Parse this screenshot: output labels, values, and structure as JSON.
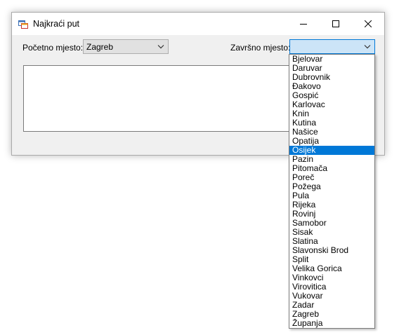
{
  "window": {
    "title": "Najkraći put"
  },
  "form": {
    "start_label": "Početno mjesto:",
    "start_value": "Zagreb",
    "end_label": "Završno mjesto:",
    "end_value": ""
  },
  "dropdown": {
    "selected_index": 10,
    "items": [
      "Bjelovar",
      "Daruvar",
      "Dubrovnik",
      "Đakovo",
      "Gospić",
      "Karlovac",
      "Knin",
      "Kutina",
      "Našice",
      "Opatija",
      "Osijek",
      "Pazin",
      "Pitomača",
      "Poreč",
      "Požega",
      "Pula",
      "Rijeka",
      "Rovinj",
      "Samobor",
      "Sisak",
      "Slatina",
      "Slavonski Brod",
      "Split",
      "Velika Gorica",
      "Vinkovci",
      "Virovitica",
      "Vukovar",
      "Zadar",
      "Zagreb",
      "Županja"
    ]
  },
  "icons": {
    "app": "app-window-icon",
    "minimize": "minimize-icon",
    "maximize": "maximize-icon",
    "close": "close-icon",
    "dropdown": "chevron-down-icon"
  },
  "colors": {
    "accent": "#0078d7",
    "focus_fill": "#cce4f7",
    "window_bg": "#f0f0f0"
  }
}
